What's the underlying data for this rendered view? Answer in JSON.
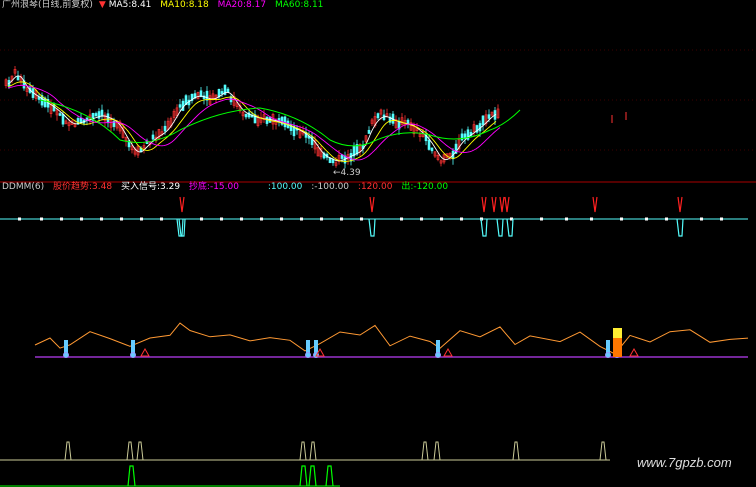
{
  "header": {
    "title": "广州浪琴(日线,前复权)",
    "arrow": "▼",
    "ma5": "MA5:8.41",
    "ma10": "MA10:8.18",
    "ma20": "MA20:8.17",
    "ma60": "MA60:8.11"
  },
  "indicator": {
    "name": "DDMM(6)",
    "trend": "股价趋势:3.48",
    "buy": "买入信号:3.29",
    "bottom": "抄底:-15.00",
    "v1": ":100.00",
    "v2": ":-100.00",
    "v3": ":120.00",
    "out": "出:-120.00"
  },
  "annotation": {
    "low": "←4.39"
  },
  "watermark": "www.7gpzb.com",
  "colors": {
    "ma5": "#ffffff",
    "ma10": "#ffff00",
    "ma20": "#ff00ff",
    "ma60": "#00ff00",
    "up": "#ff3232",
    "down": "#54fcfc",
    "trend": "#ff9933",
    "baseline": "#9933cc",
    "ddline": "#54fcfc",
    "ddred": "#ff2020",
    "sig1": "#cccc99",
    "sig2": "#00ff00",
    "panelline": "#aa0000"
  },
  "chart_data": [
    {
      "type": "candlestick",
      "series": [
        {
          "name": "MA5",
          "values": []
        },
        {
          "name": "MA10",
          "values": []
        },
        {
          "name": "MA20",
          "values": []
        },
        {
          "name": "MA60",
          "values": []
        }
      ],
      "annotations": [
        "←4.39"
      ]
    },
    {
      "type": "line",
      "levels": [
        100,
        -100,
        120,
        -120
      ],
      "signal_x": [
        182,
        372,
        484,
        494,
        502,
        507,
        595,
        680
      ],
      "dots_x": [
        18,
        40,
        60,
        80,
        100,
        120,
        140,
        160,
        200,
        220,
        240,
        260,
        280,
        300,
        320,
        340,
        360,
        400,
        420,
        440,
        460,
        480,
        510,
        540,
        565,
        590,
        620,
        645,
        665,
        700,
        720
      ]
    },
    {
      "type": "line",
      "signals_up": [
        66,
        133,
        308,
        316,
        438,
        608,
        617
      ],
      "triangles": [
        145,
        320,
        448,
        634
      ]
    },
    {
      "type": "line",
      "pulses_top": [
        68,
        130,
        140,
        303,
        313,
        425,
        437,
        516,
        603
      ],
      "pulses_bottom": [
        131,
        303,
        312,
        329
      ]
    }
  ]
}
